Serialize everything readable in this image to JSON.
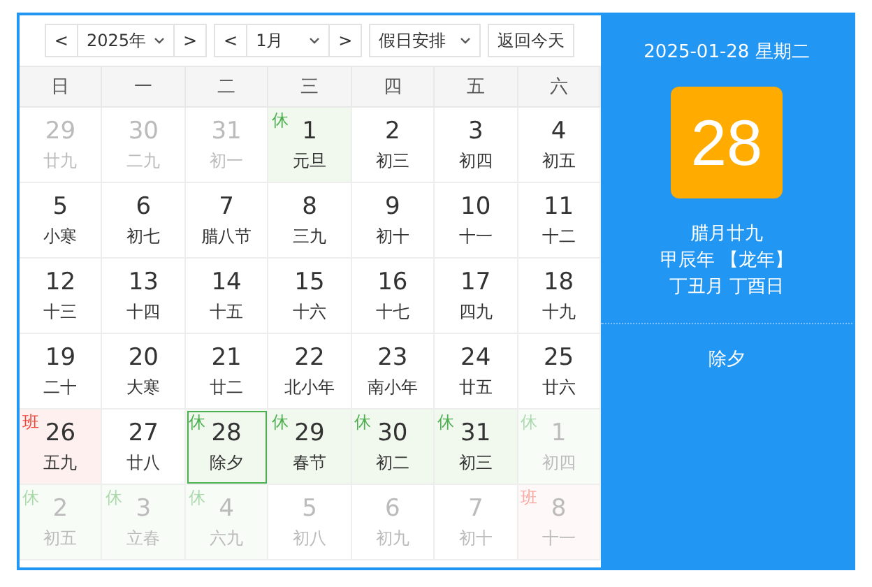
{
  "toolbar": {
    "year_prev": "<",
    "year": "2025年",
    "year_next": ">",
    "month_prev": "<",
    "month": "1月",
    "month_next": ">",
    "holiday_select": "假日安排",
    "today_button": "返回今天"
  },
  "weekdays": [
    "日",
    "一",
    "二",
    "三",
    "四",
    "五",
    "六"
  ],
  "days": [
    {
      "day": "29",
      "lunar": "廿九",
      "other_month": true,
      "selected": false
    },
    {
      "day": "30",
      "lunar": "二九",
      "other_month": true,
      "selected": false
    },
    {
      "day": "31",
      "lunar": "初一",
      "other_month": true,
      "selected": false
    },
    {
      "day": "1",
      "lunar": "元旦",
      "other_month": false,
      "selected": false,
      "tag": {
        "text": "休",
        "kind": "rest"
      }
    },
    {
      "day": "2",
      "lunar": "初三",
      "other_month": false,
      "selected": false
    },
    {
      "day": "3",
      "lunar": "初四",
      "other_month": false,
      "selected": false
    },
    {
      "day": "4",
      "lunar": "初五",
      "other_month": false,
      "selected": false
    },
    {
      "day": "5",
      "lunar": "小寒",
      "other_month": false,
      "selected": false
    },
    {
      "day": "6",
      "lunar": "初七",
      "other_month": false,
      "selected": false
    },
    {
      "day": "7",
      "lunar": "腊八节",
      "other_month": false,
      "selected": false
    },
    {
      "day": "8",
      "lunar": "三九",
      "other_month": false,
      "selected": false
    },
    {
      "day": "9",
      "lunar": "初十",
      "other_month": false,
      "selected": false
    },
    {
      "day": "10",
      "lunar": "十一",
      "other_month": false,
      "selected": false
    },
    {
      "day": "11",
      "lunar": "十二",
      "other_month": false,
      "selected": false
    },
    {
      "day": "12",
      "lunar": "十三",
      "other_month": false,
      "selected": false
    },
    {
      "day": "13",
      "lunar": "十四",
      "other_month": false,
      "selected": false
    },
    {
      "day": "14",
      "lunar": "十五",
      "other_month": false,
      "selected": false
    },
    {
      "day": "15",
      "lunar": "十六",
      "other_month": false,
      "selected": false
    },
    {
      "day": "16",
      "lunar": "十七",
      "other_month": false,
      "selected": false
    },
    {
      "day": "17",
      "lunar": "四九",
      "other_month": false,
      "selected": false
    },
    {
      "day": "18",
      "lunar": "十九",
      "other_month": false,
      "selected": false
    },
    {
      "day": "19",
      "lunar": "二十",
      "other_month": false,
      "selected": false
    },
    {
      "day": "20",
      "lunar": "大寒",
      "other_month": false,
      "selected": false
    },
    {
      "day": "21",
      "lunar": "廿二",
      "other_month": false,
      "selected": false
    },
    {
      "day": "22",
      "lunar": "北小年",
      "other_month": false,
      "selected": false
    },
    {
      "day": "23",
      "lunar": "南小年",
      "other_month": false,
      "selected": false
    },
    {
      "day": "24",
      "lunar": "廿五",
      "other_month": false,
      "selected": false
    },
    {
      "day": "25",
      "lunar": "廿六",
      "other_month": false,
      "selected": false
    },
    {
      "day": "26",
      "lunar": "五九",
      "other_month": false,
      "selected": false,
      "tag": {
        "text": "班",
        "kind": "work"
      }
    },
    {
      "day": "27",
      "lunar": "廿八",
      "other_month": false,
      "selected": false
    },
    {
      "day": "28",
      "lunar": "除夕",
      "other_month": false,
      "selected": true,
      "tag": {
        "text": "休",
        "kind": "rest"
      }
    },
    {
      "day": "29",
      "lunar": "春节",
      "other_month": false,
      "selected": false,
      "tag": {
        "text": "休",
        "kind": "rest"
      }
    },
    {
      "day": "30",
      "lunar": "初二",
      "other_month": false,
      "selected": false,
      "tag": {
        "text": "休",
        "kind": "rest"
      }
    },
    {
      "day": "31",
      "lunar": "初三",
      "other_month": false,
      "selected": false,
      "tag": {
        "text": "休",
        "kind": "rest"
      }
    },
    {
      "day": "1",
      "lunar": "初四",
      "other_month": true,
      "selected": false,
      "tag": {
        "text": "休",
        "kind": "rest"
      }
    },
    {
      "day": "2",
      "lunar": "初五",
      "other_month": true,
      "selected": false,
      "tag": {
        "text": "休",
        "kind": "rest"
      }
    },
    {
      "day": "3",
      "lunar": "立春",
      "other_month": true,
      "selected": false,
      "tag": {
        "text": "休",
        "kind": "rest"
      }
    },
    {
      "day": "4",
      "lunar": "六九",
      "other_month": true,
      "selected": false,
      "tag": {
        "text": "休",
        "kind": "rest"
      }
    },
    {
      "day": "5",
      "lunar": "初八",
      "other_month": true,
      "selected": false
    },
    {
      "day": "6",
      "lunar": "初九",
      "other_month": true,
      "selected": false
    },
    {
      "day": "7",
      "lunar": "初十",
      "other_month": true,
      "selected": false
    },
    {
      "day": "8",
      "lunar": "十一",
      "other_month": true,
      "selected": false,
      "tag": {
        "text": "班",
        "kind": "work"
      }
    }
  ],
  "detail": {
    "date_line": "2025-01-28 星期二",
    "big_day": "28",
    "lunar_lines": [
      "腊月廿九",
      "甲辰年 【龙年】",
      "丁丑月 丁酉日"
    ],
    "festival": "除夕"
  }
}
